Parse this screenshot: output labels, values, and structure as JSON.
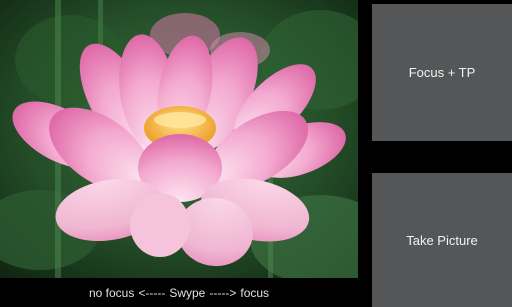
{
  "viewfinder": {
    "subject": "pink lotus flower preview",
    "colors": {
      "petal": "#f29fcb",
      "petal_dark": "#d45b9e",
      "center": "#f5b13a",
      "leaf": "#2f5e33",
      "leaf_dark": "#173019"
    }
  },
  "gesture_hint": {
    "left": "no focus",
    "arrow_left": "<-----",
    "middle": "Swype",
    "arrow_right": "----->",
    "right": "focus"
  },
  "buttons": {
    "focus_tp": "Focus + TP",
    "take_picture": "Take Picture"
  }
}
